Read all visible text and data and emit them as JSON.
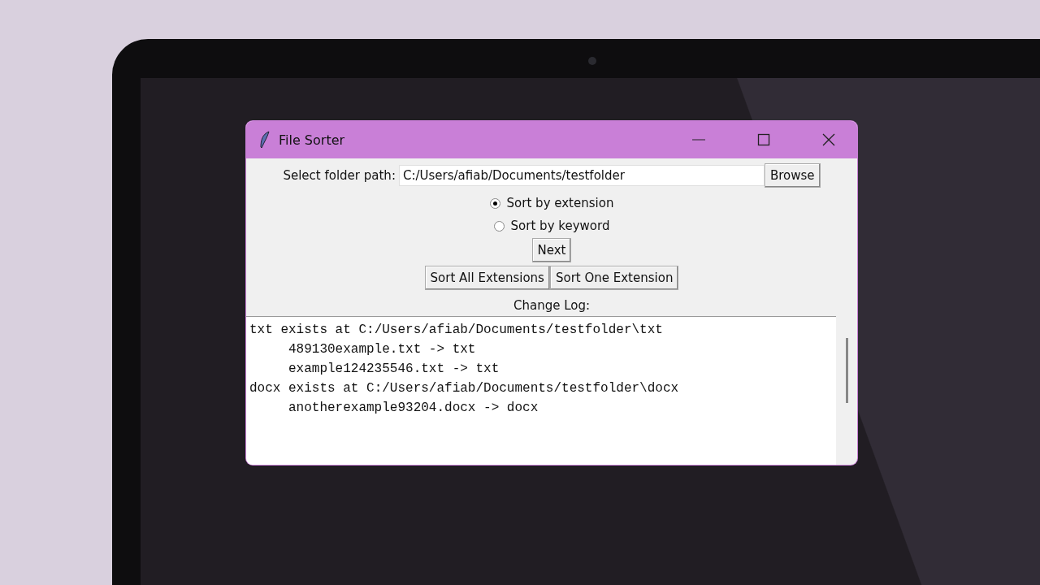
{
  "window": {
    "title": "File Sorter"
  },
  "folder": {
    "label": "Select folder path:",
    "value": "C:/Users/afiab/Documents/testfolder",
    "button": "Browse"
  },
  "sort_options": [
    {
      "label": "Sort by extension",
      "selected": true
    },
    {
      "label": "Sort by keyword",
      "selected": false
    }
  ],
  "next_button": "Next",
  "action_buttons": [
    "Sort All Extensions",
    "Sort One Extension"
  ],
  "log": {
    "label": "Change Log:",
    "entries": [
      {
        "text": "txt exists at C:/Users/afiab/Documents/testfolder\\txt",
        "children": [
          {
            "text": "489130example.txt -> txt"
          },
          {
            "text": "example124235546.txt -> txt"
          }
        ]
      },
      {
        "text": "docx exists at C:/Users/afiab/Documents/testfolder\\docx",
        "children": [
          {
            "text": "anotherexample93204.docx -> docx"
          }
        ]
      }
    ]
  }
}
